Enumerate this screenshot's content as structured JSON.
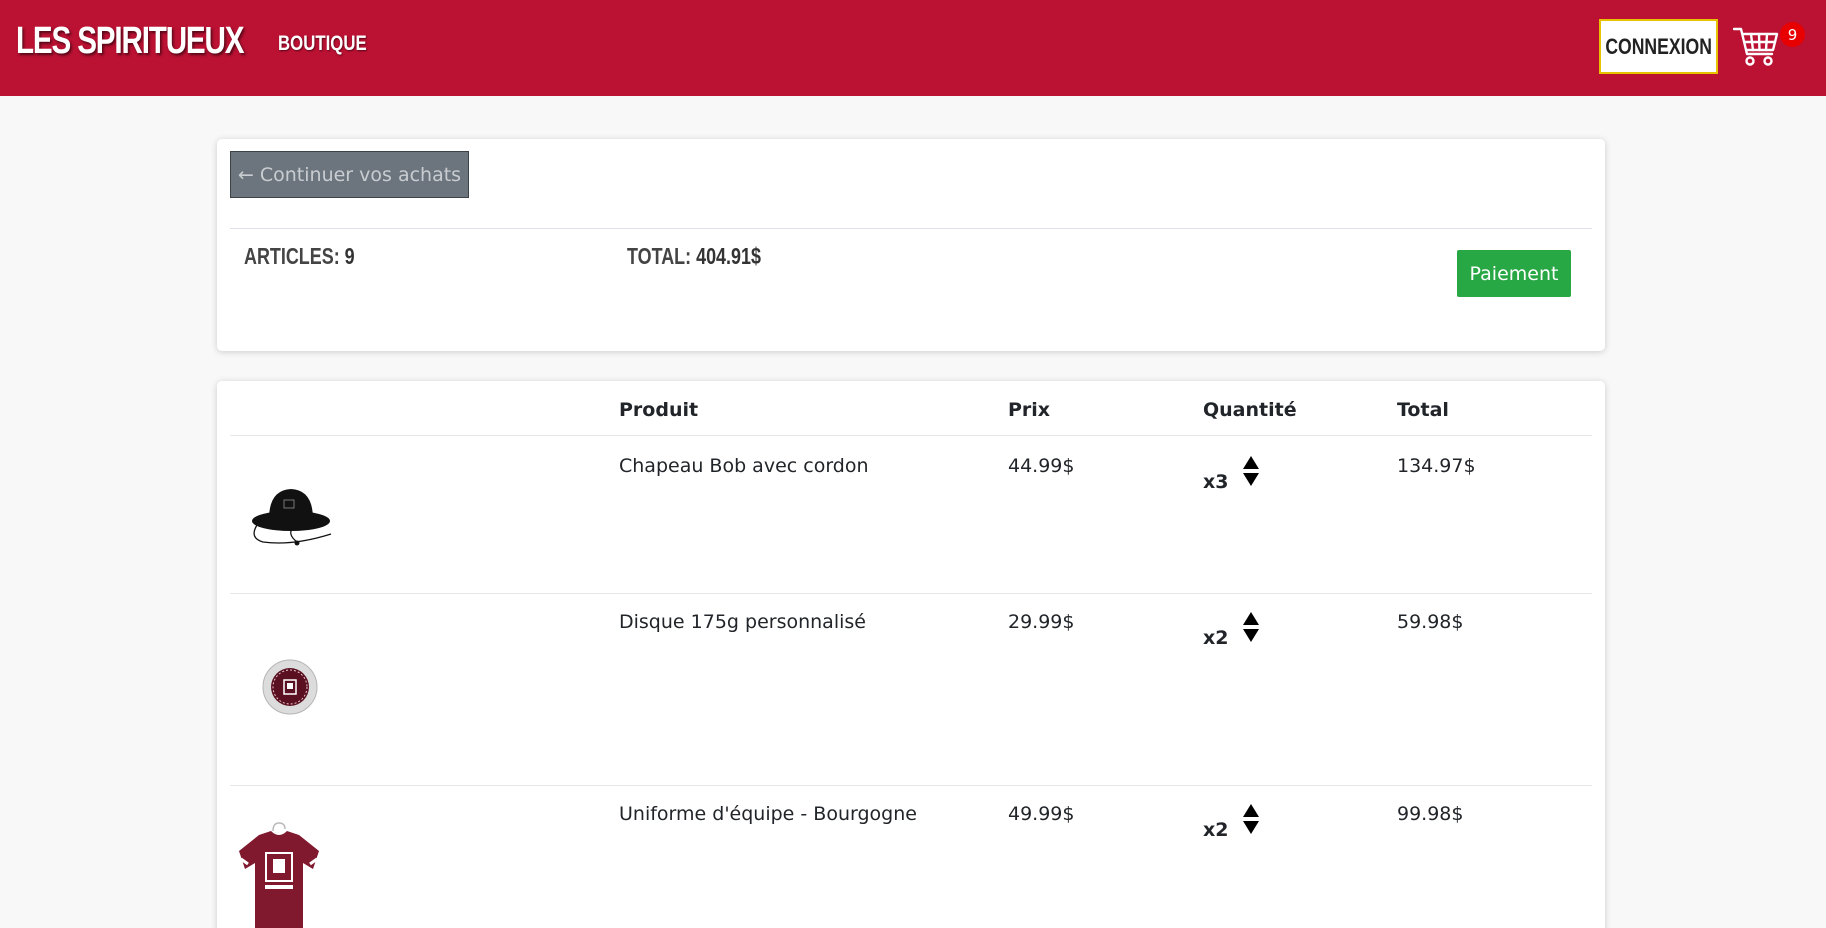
{
  "header": {
    "brand": "LES SPIRITUEUX",
    "nav_link": "BOUTIQUE",
    "login_label": "CONNEXION",
    "cart_count": "9",
    "brand_color": "#bb1133"
  },
  "summary": {
    "continue_label": "← Continuer vos achats",
    "articles_label": "ARTICLES:",
    "articles_value": "9",
    "total_label": "TOTAL:",
    "total_value": "404.91$",
    "pay_label": "Paiement"
  },
  "table": {
    "headers": [
      "Produit",
      "Prix",
      "Quantité",
      "Total"
    ],
    "rows": [
      {
        "name": "Chapeau Bob avec cordon",
        "price": "44.99$",
        "qty": "x3",
        "total": "134.97$",
        "image": "bucket-hat-image"
      },
      {
        "name": "Disque 175g personnalisé",
        "price": "29.99$",
        "qty": "x2",
        "total": "59.98$",
        "image": "disc-image"
      },
      {
        "name": "Uniforme d'équipe - Bourgogne",
        "price": "49.99$",
        "qty": "x2",
        "total": "99.98$",
        "image": "jersey-image"
      }
    ]
  },
  "colors": {
    "accent": "#bb1133",
    "pay": "#28a745",
    "continue": "#6c757d"
  }
}
